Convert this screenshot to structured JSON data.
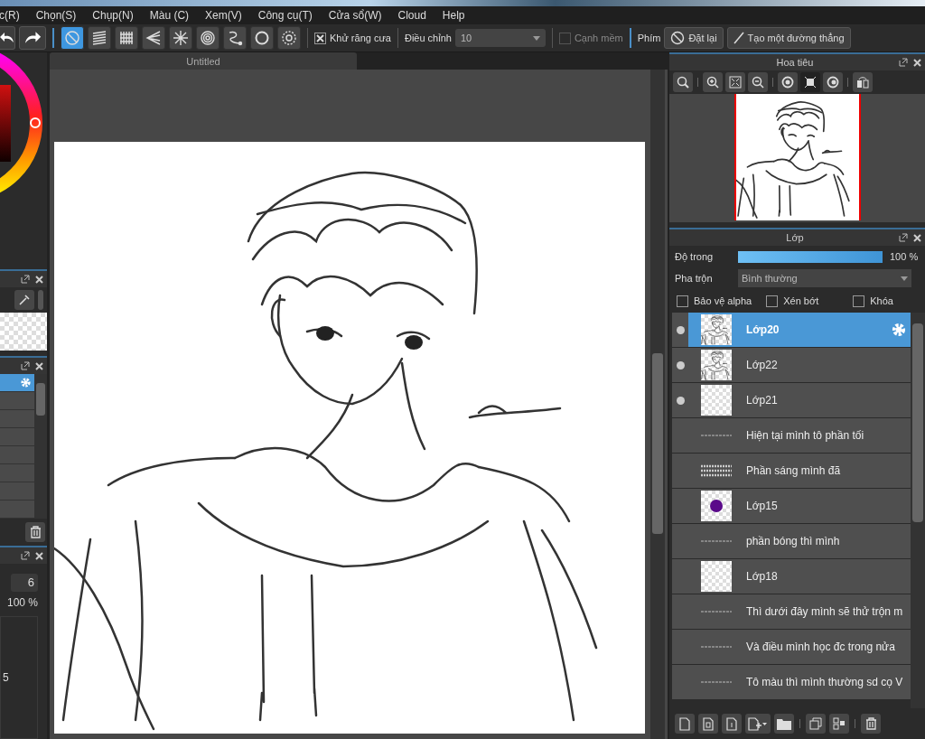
{
  "menu": [
    "c(R)",
    "Chọn(S)",
    "Chụp(N)",
    "Màu (C)",
    "Xem(V)",
    "Công cụ(T)",
    "Cửa sổ(W)",
    "Cloud",
    "Help"
  ],
  "toolbar": {
    "tools": [
      {
        "kind": "forbid",
        "selected": true
      },
      {
        "kind": "hatch",
        "selected": false
      },
      {
        "kind": "grid",
        "selected": false
      },
      {
        "kind": "fan",
        "selected": false
      },
      {
        "kind": "burst",
        "selected": false
      },
      {
        "kind": "rings",
        "selected": false
      },
      {
        "kind": "curve",
        "selected": false
      },
      {
        "kind": "circle",
        "selected": false
      },
      {
        "kind": "gear",
        "selected": false
      }
    ],
    "antialias": {
      "label": "Khử răng cưa",
      "checked": true
    },
    "adjust_label": "Điều chỉnh",
    "adjust_value": "10",
    "soft_edge": {
      "label": "Cạnh mềm",
      "checked": false
    },
    "keys_label": "Phím",
    "reset_button": "Đặt lại",
    "line_button": "Tạo một đường thẳng"
  },
  "canvas_tab": "Untitled",
  "left_panels": {
    "list": [
      {
        "selected": true
      },
      {
        "selected": false
      },
      {
        "selected": false
      },
      {
        "selected": false
      },
      {
        "selected": false
      },
      {
        "selected": false
      },
      {
        "selected": false
      },
      {
        "selected": false
      }
    ],
    "size_value": "6",
    "opacity_value": "100 %",
    "item_value": "5"
  },
  "navigator": {
    "title": "Hoa tiêu"
  },
  "layers_panel": {
    "title": "Lớp",
    "opacity_label": "Độ trong",
    "opacity": {
      "level": 1.0
    },
    "opacity_reading": "100 %",
    "blend_label": "Pha trộn",
    "blend_value": "Bình thường",
    "options": [
      {
        "label": "Bảo vệ alpha",
        "checked": false
      },
      {
        "label": "Xén bớt",
        "checked": false
      },
      {
        "label": "Khóa",
        "checked": false
      }
    ],
    "layers": [
      {
        "name": "Lớp20",
        "visible": true,
        "selected": true,
        "kind": "sketch"
      },
      {
        "name": "Lớp22",
        "visible": true,
        "selected": false,
        "kind": "sketch"
      },
      {
        "name": "Lớp21",
        "visible": true,
        "selected": false,
        "kind": "empty"
      },
      {
        "name": "Hiện tại mình tô phần tối",
        "visible": false,
        "selected": false,
        "kind": "line"
      },
      {
        "name": "Phần sáng mình đã",
        "visible": false,
        "selected": false,
        "kind": "text"
      },
      {
        "name": "Lớp15",
        "visible": false,
        "selected": false,
        "kind": "dot"
      },
      {
        "name": "phần bóng thì mình",
        "visible": false,
        "selected": false,
        "kind": "line"
      },
      {
        "name": "Lớp18",
        "visible": false,
        "selected": false,
        "kind": "empty"
      },
      {
        "name": "Thì dưới đây mình sẽ thử trộn m",
        "visible": false,
        "selected": false,
        "kind": "line"
      },
      {
        "name": "Và điều mình học đc trong nửa",
        "visible": false,
        "selected": false,
        "kind": "line"
      },
      {
        "name": "Tô màu thì mình thường sd cọ V",
        "visible": false,
        "selected": false,
        "kind": "line"
      }
    ]
  }
}
